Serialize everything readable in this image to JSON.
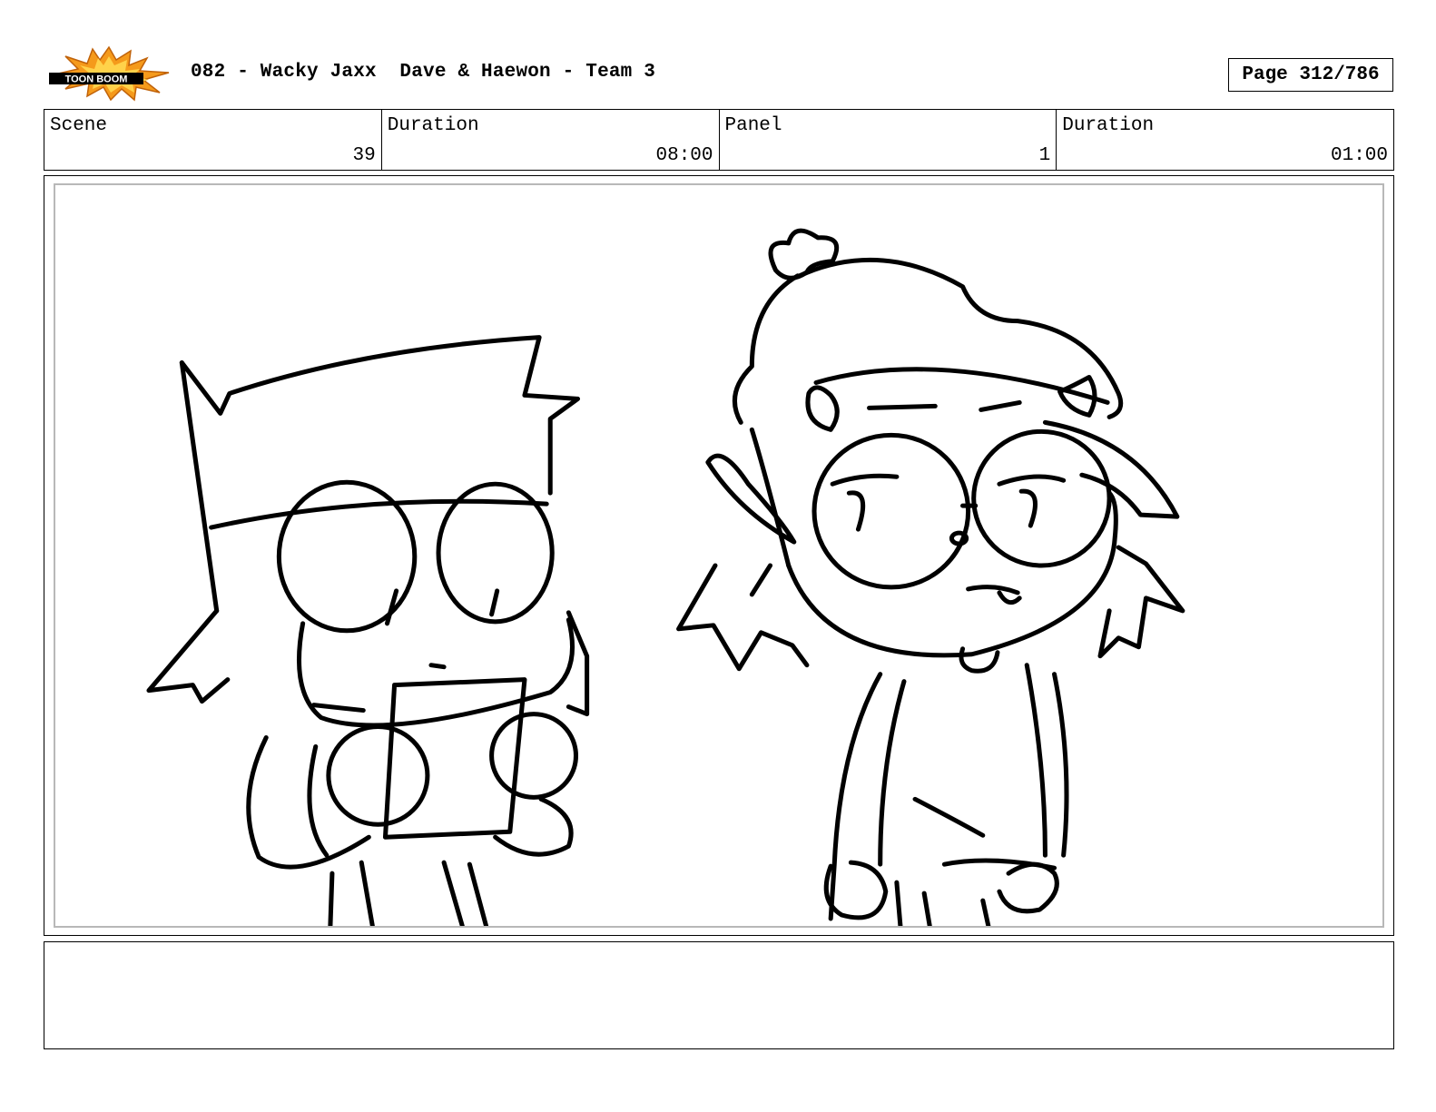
{
  "header": {
    "logo_text": "TOONBOOM",
    "title": "082 - Wacky Jaxx  Dave & Haewon - Team 3",
    "page": "Page 312/786"
  },
  "info": [
    {
      "label": "Scene",
      "value": "39"
    },
    {
      "label": "Duration",
      "value": "08:00"
    },
    {
      "label": "Panel",
      "value": "1"
    },
    {
      "label": "Duration",
      "value": "01:00"
    }
  ],
  "notes": {
    "text": ""
  },
  "colors": {
    "logo_burst": "#f59a1b",
    "logo_burst_inner": "#ffd24a",
    "lines": "#000000"
  }
}
